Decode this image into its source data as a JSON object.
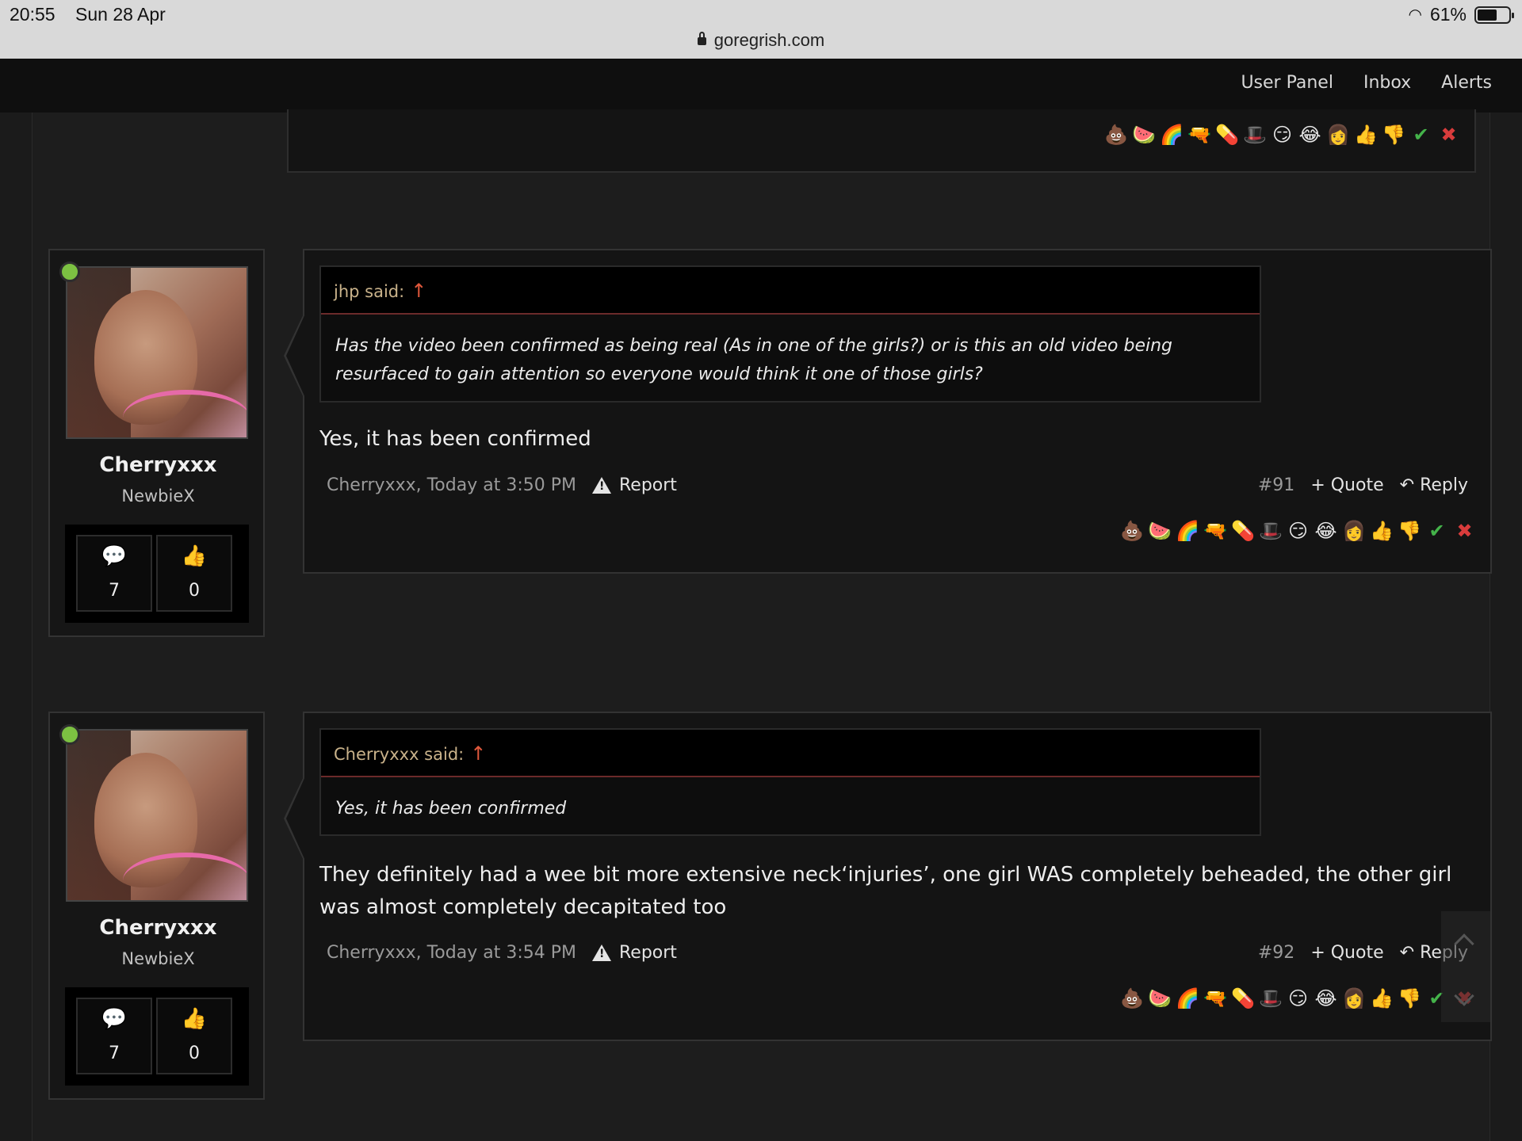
{
  "status_bar": {
    "time": "20:55",
    "date": "Sun 28 Apr",
    "battery": "61%"
  },
  "browser": {
    "url": "goregrish.com"
  },
  "nav": {
    "links": [
      "User Panel",
      "Inbox",
      "Alerts"
    ]
  },
  "reactions": [
    "💩",
    "🍉",
    "🌈",
    "🔫",
    "💊",
    "🎩",
    "😏",
    "😂",
    "👩",
    "👍",
    "👎",
    "✔",
    "✖"
  ],
  "posts": [
    {
      "username": "Cherryxxx",
      "user_title": "NewbieX",
      "messages_count": "7",
      "likes_count": "0",
      "quote_author": "jhp said:",
      "quote_text": "Has the video been confirmed as being real (As in one of the girls?) or is this an old video being resurfaced to gain attention so everyone would think it one of those girls?",
      "body": "Yes, it has been confirmed",
      "meta": "Cherryxxx, Today at 3:50 PM",
      "report_label": "Report",
      "post_number": "#91",
      "quote_label": "+ Quote",
      "reply_label": "Reply"
    },
    {
      "username": "Cherryxxx",
      "user_title": "NewbieX",
      "messages_count": "7",
      "likes_count": "0",
      "quote_author": "Cherryxxx said:",
      "quote_text": "Yes, it has been confirmed",
      "body": "They definitely had a wee bit more extensive neck‘injuries’, one girl WAS completely beheaded, the other girl was almost completely decapitated too",
      "meta": "Cherryxxx, Today at 3:54 PM",
      "report_label": "Report",
      "post_number": "#92",
      "quote_label": "+ Quote",
      "reply_label": "Reply"
    }
  ]
}
